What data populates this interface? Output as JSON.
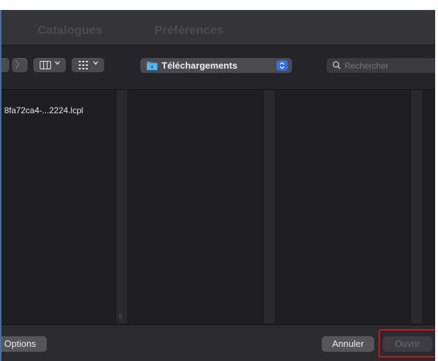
{
  "header": {
    "tabs": [
      {
        "label": "Catalogues"
      },
      {
        "label": "Préférences"
      }
    ]
  },
  "toolbar": {
    "forward_glyph": "〉",
    "view_icon": "columns-view-icon",
    "group_icon": "grid-view-icon",
    "location": {
      "label": "Téléchargements",
      "icon": "folder-icon"
    },
    "search": {
      "placeholder": "Rechercher",
      "icon": "search-icon"
    }
  },
  "browser": {
    "columns": [
      {
        "items": [
          {
            "name": "8fa72ca4-...2224.lcpl"
          }
        ]
      },
      {
        "items": []
      },
      {
        "items": []
      }
    ],
    "handle_glyph": "||"
  },
  "footer": {
    "options_label": "Options",
    "cancel_label": "Annuler",
    "open_label": "Ouvrir"
  },
  "colors": {
    "accent": "#2e6cf0",
    "highlight_frame": "#c4161c",
    "background": "#1f1e23"
  }
}
